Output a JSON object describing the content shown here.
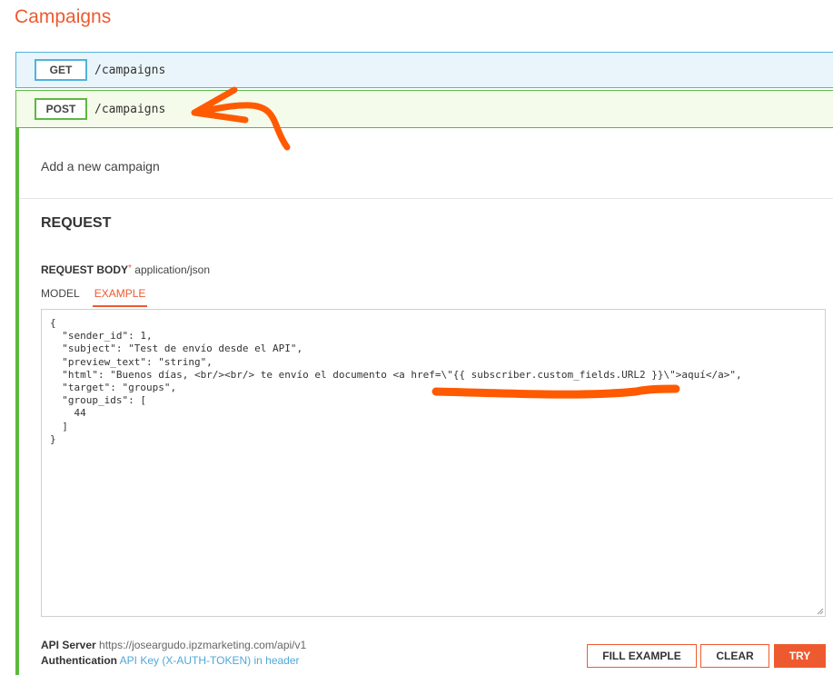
{
  "section": {
    "title": "Campaigns"
  },
  "operations": [
    {
      "method": "GET",
      "path": "/campaigns"
    },
    {
      "method": "POST",
      "path": "/campaigns"
    }
  ],
  "post_operation": {
    "description": "Add a new campaign",
    "request_title": "REQUEST",
    "request_body_label": "REQUEST BODY",
    "required_marker": "*",
    "content_type": "application/json",
    "tabs": [
      {
        "label": "MODEL",
        "active": false
      },
      {
        "label": "EXAMPLE",
        "active": true
      }
    ],
    "body_example": "{\n  \"sender_id\": 1,\n  \"subject\": \"Test de envío desde el API\",\n  \"preview_text\": \"string\",\n  \"html\": \"Buenos días, <br/><br/> te envío el documento <a href=\\\"{{ subscriber.custom_fields.URL2 }}\\\">aquí</a>\",\n  \"target\": \"groups\",\n  \"group_ids\": [\n    44\n  ]\n}"
  },
  "footer": {
    "api_server_label": "API Server",
    "api_server_value": "https://joseargudo.ipzmarketing.com/api/v1",
    "authentication_label": "Authentication",
    "authentication_value": "API Key (X-AUTH-TOKEN) in header"
  },
  "buttons": {
    "fill_example": "FILL EXAMPLE",
    "clear": "CLEAR",
    "try": "TRY"
  },
  "colors": {
    "accent": "#ee5a2f",
    "get": "#4fb3dc",
    "post": "#5eb840",
    "annotation": "#ff5a00"
  }
}
